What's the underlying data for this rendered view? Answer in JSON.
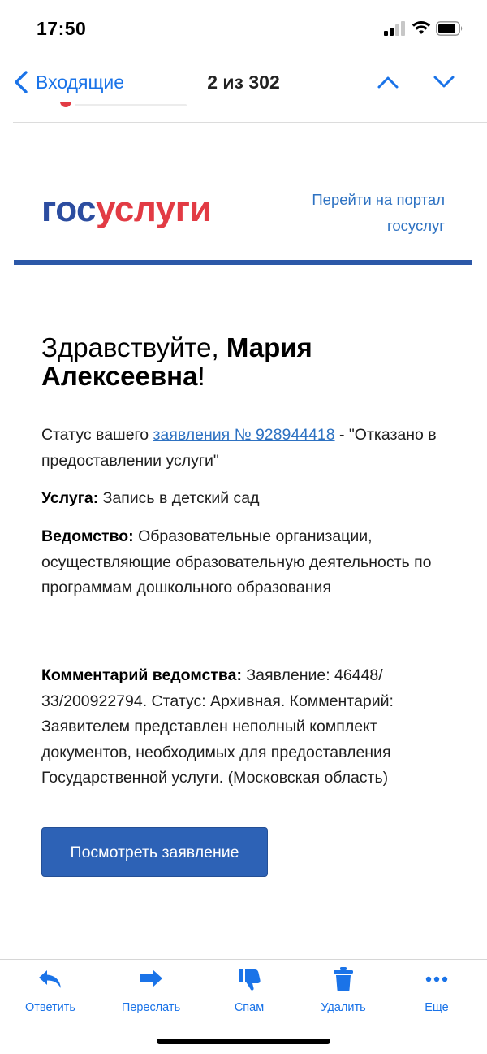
{
  "status_bar": {
    "time": "17:50"
  },
  "nav": {
    "back_label": "Входящие",
    "counter": "2 из 302"
  },
  "email": {
    "logo": {
      "part1": "гос",
      "part2": "услуги"
    },
    "portal_link": "Перейти на портал госуслуг",
    "greeting": {
      "prefix": "Здравствуйте, ",
      "name": "Мария Алексеевна",
      "suffix": "!"
    },
    "status": {
      "prefix": "Статус вашего ",
      "link": "заявления № 928944418",
      "suffix": " - \"Отказано в предоставлении услуги\""
    },
    "service": {
      "label": "Услуга:",
      "value": " Запись в детский сад"
    },
    "department": {
      "label": "Ведомство:",
      "value": " Образовательные организации, осуществляющие образовательную деятельность по программам дошкольного образования"
    },
    "comment": {
      "label": "Комментарий ведомства:",
      "value": " Заявление: 46448/ 33/200922794. Статус: Архивная. Комментарий: Заявителем представлен неполный комплект документов, необходимых для предоставления Государственной услуги. (Московская область)"
    },
    "button": "Посмотреть заявление"
  },
  "toolbar": {
    "items": [
      {
        "label": "Ответить",
        "icon": "reply-icon"
      },
      {
        "label": "Переслать",
        "icon": "forward-icon"
      },
      {
        "label": "Спам",
        "icon": "thumbs-down-icon"
      },
      {
        "label": "Удалить",
        "icon": "trash-icon"
      },
      {
        "label": "Еще",
        "icon": "more-icon"
      }
    ]
  },
  "colors": {
    "accent": "#1a73e8",
    "gos_blue": "#2c4da0",
    "gos_red": "#e23b44",
    "button": "#2d62b6"
  }
}
